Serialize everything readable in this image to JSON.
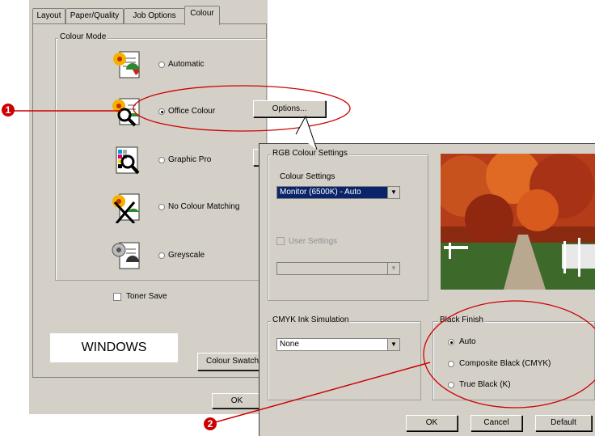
{
  "tabs": [
    "Layout",
    "Paper/Quality",
    "Job Options",
    "Colour"
  ],
  "colour_mode": {
    "title": "Colour Mode",
    "options": [
      {
        "label": "Automatic",
        "selected": false,
        "icon": "colour-document-icon"
      },
      {
        "label": "Office Colour",
        "selected": true,
        "icon": "office-colour-magnifier-icon"
      },
      {
        "label": "Graphic Pro",
        "selected": false,
        "icon": "graphic-pro-magnifier-icon"
      },
      {
        "label": "No Colour Matching",
        "selected": false,
        "icon": "no-colour-matching-icon"
      },
      {
        "label": "Greyscale",
        "selected": false,
        "icon": "greyscale-document-icon"
      }
    ],
    "options_button": "Options..."
  },
  "toner_save": {
    "label": "Toner Save",
    "checked": false
  },
  "platform_label": "WINDOWS",
  "colour_swatch_button": "Colour Swatch",
  "ok_button": "OK",
  "rgb_settings": {
    "title": "RGB Colour Settings",
    "colour_settings_label": "Colour Settings",
    "colour_settings_value": "Monitor (6500K) - Auto",
    "user_settings_label": "User Settings",
    "user_settings_checked": false,
    "user_settings_value": ""
  },
  "cmyk": {
    "title": "CMYK Ink Simulation",
    "value": "None"
  },
  "black_finish": {
    "title": "Black Finish",
    "options": [
      {
        "label": "Auto",
        "selected": true
      },
      {
        "label": "Composite Black (CMYK)",
        "selected": false
      },
      {
        "label": "True Black (K)",
        "selected": false
      }
    ]
  },
  "dialog_buttons": {
    "ok": "OK",
    "cancel": "Cancel",
    "default": "Default"
  },
  "callouts": {
    "one": "1",
    "two": "2"
  },
  "colors": {
    "dialog_bg": "#d4d0c8",
    "callout_red": "#cc0000",
    "select_highlight": "#0a246a"
  }
}
